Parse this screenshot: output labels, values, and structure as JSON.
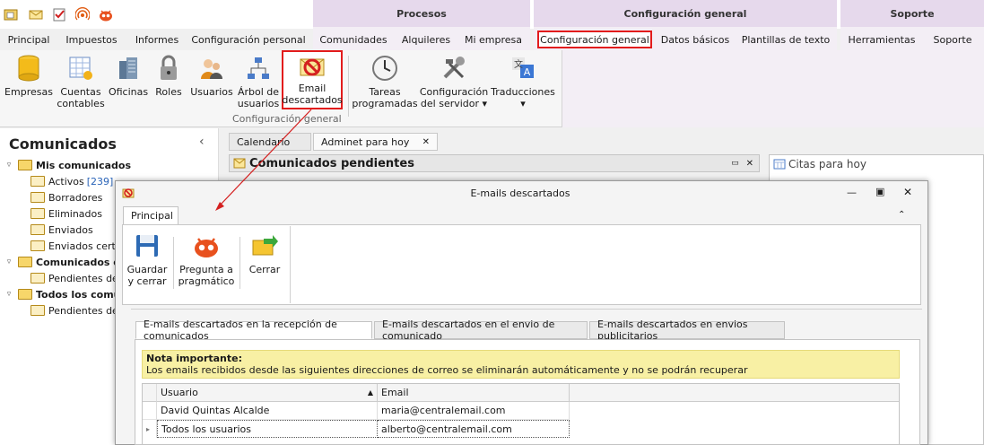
{
  "ribbon_tabs": {
    "principal": "Principal",
    "impuestos": "Impuestos",
    "informes": "Informes",
    "config_personal": "Configuración personal",
    "comunidades": "Comunidades",
    "alquileres": "Alquileres",
    "mi_empresa": "Mi empresa",
    "config_general": "Configuración general",
    "datos_basicos": "Datos básicos",
    "plantillas": "Plantillas de texto",
    "herramientas": "Herramientas",
    "soporte": "Soporte"
  },
  "context_headers": {
    "procesos": "Procesos",
    "config_general": "Configuración general",
    "soporte": "Soporte"
  },
  "ribbon_buttons": {
    "empresas": "Empresas",
    "cuentas_contables_1": "Cuentas",
    "cuentas_contables_2": "contables",
    "oficinas": "Oficinas",
    "roles": "Roles",
    "usuarios": "Usuarios",
    "arbol_1": "Árbol de",
    "arbol_2": "usuarios",
    "email_1": "Email",
    "email_2": "descartados",
    "tareas_1": "Tareas",
    "tareas_2": "programadas",
    "config_servidor_1": "Configuración",
    "config_servidor_2": "del servidor",
    "traducciones": "Traducciones",
    "group_label": "Configuración general"
  },
  "left_pane": {
    "title": "Comunicados",
    "collapse": "‹",
    "tree": [
      {
        "label": "Mis comunicados",
        "bold": true,
        "level": 0
      },
      {
        "label": "Activos",
        "count": "[239]",
        "level": 1
      },
      {
        "label": "Borradores",
        "level": 1
      },
      {
        "label": "Eliminados",
        "level": 1
      },
      {
        "label": "Enviados",
        "level": 1
      },
      {
        "label": "Enviados cert",
        "level": 1
      },
      {
        "label": "Comunicados de",
        "bold": true,
        "level": 0
      },
      {
        "label": "Pendientes de",
        "level": 1
      },
      {
        "label": "Todos los comu",
        "bold": true,
        "level": 0
      },
      {
        "label": "Pendientes de",
        "level": 1
      }
    ]
  },
  "doc_tabs": {
    "calendario": "Calendario",
    "adminet": "Adminet para hoy",
    "close": "✕"
  },
  "panels": {
    "comunicados_pendientes": "Comunicados pendientes",
    "citas_para_hoy": "Citas para hoy"
  },
  "dialog": {
    "title": "E-mails descartados",
    "tab": "Principal",
    "buttons": {
      "guardar_1": "Guardar",
      "guardar_2": "y cerrar",
      "pregunta_1": "Pregunta a",
      "pregunta_2": "pragmático",
      "cerrar": "Cerrar"
    },
    "inner_tabs": [
      "E-mails descartados en la recepción de comunicados",
      "E-mails descartados en el envio de comunicado",
      "E-mails descartados en envios publicitarios"
    ],
    "note_title": "Nota importante:",
    "note_text": "Los emails recibidos desde las siguientes direcciones de correo se eliminarán automáticamente y no se podrán recuperar",
    "grid": {
      "headers": {
        "usuario": "Usuario",
        "email": "Email"
      },
      "rows": [
        {
          "usuario": "David Quintas Alcalde",
          "email": "maria@centralemail.com"
        },
        {
          "usuario": "Todos los usuarios",
          "email": "alberto@centralemail.com"
        }
      ]
    }
  },
  "colors": {
    "highlight": "#e21c1c",
    "context_tab": "#e6d9ec",
    "note_bg": "#f8f0a4"
  }
}
